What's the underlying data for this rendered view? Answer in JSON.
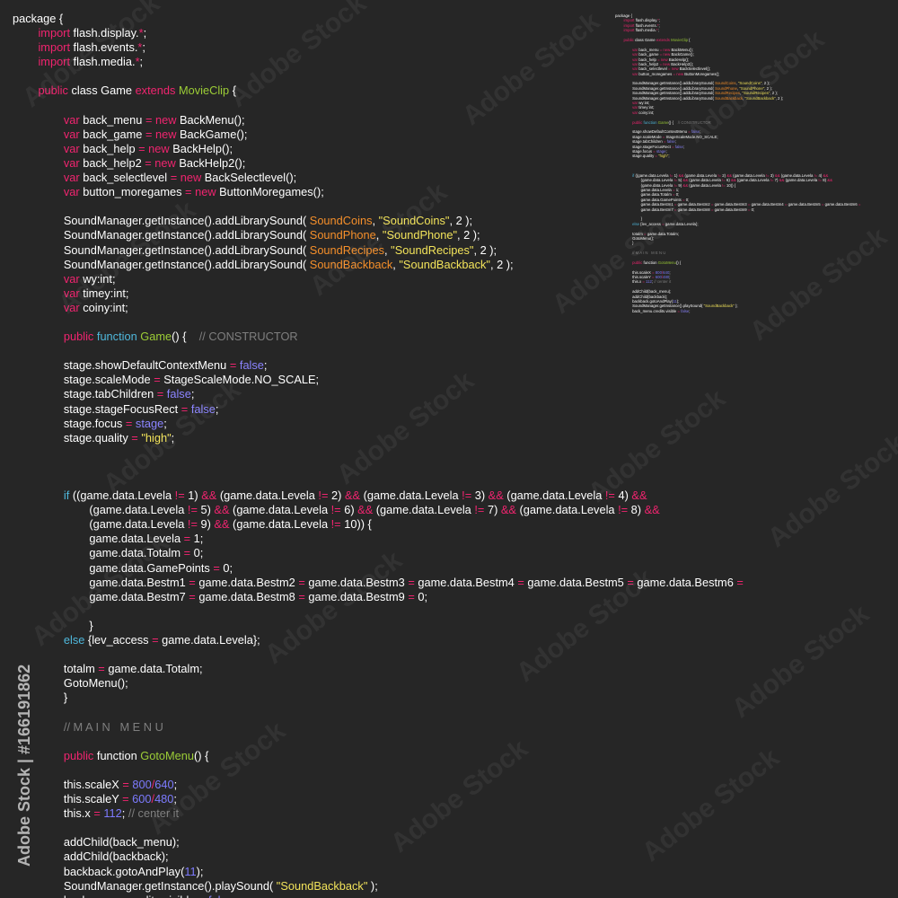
{
  "code": {
    "lines": [
      [
        {
          "t": "package {",
          "c": "plain"
        }
      ],
      [
        {
          "t": "        import",
          "c": "kw"
        },
        {
          "t": " flash.display.",
          "c": "plain"
        },
        {
          "t": "*",
          "c": "kw"
        },
        {
          "t": ";",
          "c": "plain"
        }
      ],
      [
        {
          "t": "        import",
          "c": "kw"
        },
        {
          "t": " flash.events.",
          "c": "plain"
        },
        {
          "t": "*",
          "c": "kw"
        },
        {
          "t": ";",
          "c": "plain"
        }
      ],
      [
        {
          "t": "        import",
          "c": "kw"
        },
        {
          "t": " flash.media.",
          "c": "plain"
        },
        {
          "t": "*",
          "c": "kw"
        },
        {
          "t": ";",
          "c": "plain"
        }
      ],
      [
        {
          "t": "",
          "c": "plain"
        }
      ],
      [
        {
          "t": "        public",
          "c": "kw"
        },
        {
          "t": " class Game ",
          "c": "plain"
        },
        {
          "t": "extends",
          "c": "kw"
        },
        {
          "t": " MovieClip",
          "c": "cls"
        },
        {
          "t": " {",
          "c": "plain"
        }
      ],
      [
        {
          "t": "",
          "c": "plain"
        }
      ],
      [
        {
          "t": "                var",
          "c": "kw"
        },
        {
          "t": " back_menu ",
          "c": "plain"
        },
        {
          "t": "=",
          "c": "kw"
        },
        {
          "t": " new",
          "c": "kw"
        },
        {
          "t": " BackMenu();",
          "c": "plain"
        }
      ],
      [
        {
          "t": "                var",
          "c": "kw"
        },
        {
          "t": " back_game ",
          "c": "plain"
        },
        {
          "t": "=",
          "c": "kw"
        },
        {
          "t": " new",
          "c": "kw"
        },
        {
          "t": " BackGame();",
          "c": "plain"
        }
      ],
      [
        {
          "t": "                var",
          "c": "kw"
        },
        {
          "t": " back_help ",
          "c": "plain"
        },
        {
          "t": "=",
          "c": "kw"
        },
        {
          "t": " new",
          "c": "kw"
        },
        {
          "t": " BackHelp();",
          "c": "plain"
        }
      ],
      [
        {
          "t": "                var",
          "c": "kw"
        },
        {
          "t": " back_help2 ",
          "c": "plain"
        },
        {
          "t": "=",
          "c": "kw"
        },
        {
          "t": " new",
          "c": "kw"
        },
        {
          "t": " BackHelp2();",
          "c": "plain"
        }
      ],
      [
        {
          "t": "                var",
          "c": "kw"
        },
        {
          "t": " back_selectlevel ",
          "c": "plain"
        },
        {
          "t": "=",
          "c": "kw"
        },
        {
          "t": " new",
          "c": "kw"
        },
        {
          "t": " BackSelectlevel();",
          "c": "plain"
        }
      ],
      [
        {
          "t": "                var",
          "c": "kw"
        },
        {
          "t": " button_moregames ",
          "c": "plain"
        },
        {
          "t": "=",
          "c": "kw"
        },
        {
          "t": " new",
          "c": "kw"
        },
        {
          "t": " ButtonMoregames();",
          "c": "plain"
        }
      ],
      [
        {
          "t": "",
          "c": "plain"
        }
      ],
      [
        {
          "t": "                SoundManager.getInstance().addLibrarySound( ",
          "c": "plain"
        },
        {
          "t": "SoundCoins",
          "c": "const"
        },
        {
          "t": ", ",
          "c": "plain"
        },
        {
          "t": "\"SoundCoins\"",
          "c": "str"
        },
        {
          "t": ", 2 );",
          "c": "plain"
        }
      ],
      [
        {
          "t": "                SoundManager.getInstance().addLibrarySound( ",
          "c": "plain"
        },
        {
          "t": "SoundPhone",
          "c": "const"
        },
        {
          "t": ", ",
          "c": "plain"
        },
        {
          "t": "\"SoundPhone\"",
          "c": "str"
        },
        {
          "t": ", 2 );",
          "c": "plain"
        }
      ],
      [
        {
          "t": "                SoundManager.getInstance().addLibrarySound( ",
          "c": "plain"
        },
        {
          "t": "SoundRecipes",
          "c": "const"
        },
        {
          "t": ", ",
          "c": "plain"
        },
        {
          "t": "\"SoundRecipes\"",
          "c": "str"
        },
        {
          "t": ", 2 );",
          "c": "plain"
        }
      ],
      [
        {
          "t": "                SoundManager.getInstance().addLibrarySound( ",
          "c": "plain"
        },
        {
          "t": "SoundBackback",
          "c": "const"
        },
        {
          "t": ", ",
          "c": "plain"
        },
        {
          "t": "\"SoundBackback\"",
          "c": "str"
        },
        {
          "t": ", 2 );",
          "c": "plain"
        }
      ],
      [
        {
          "t": "                var",
          "c": "kw"
        },
        {
          "t": " wy:int;",
          "c": "plain"
        }
      ],
      [
        {
          "t": "                var",
          "c": "kw"
        },
        {
          "t": " timey:int;",
          "c": "plain"
        }
      ],
      [
        {
          "t": "                var",
          "c": "kw"
        },
        {
          "t": " coiny:int;",
          "c": "plain"
        }
      ],
      [
        {
          "t": "",
          "c": "plain"
        }
      ],
      [
        {
          "t": "                public",
          "c": "kw"
        },
        {
          "t": " function",
          "c": "kw2"
        },
        {
          "t": " Game",
          "c": "cls"
        },
        {
          "t": "() {    ",
          "c": "plain"
        },
        {
          "t": "// CONSTRUCTOR",
          "c": "cmt"
        }
      ],
      [
        {
          "t": "",
          "c": "plain"
        }
      ],
      [
        {
          "t": "                stage.showDefaultContextMenu ",
          "c": "plain"
        },
        {
          "t": "=",
          "c": "kw"
        },
        {
          "t": " false",
          "c": "lit"
        },
        {
          "t": ";",
          "c": "plain"
        }
      ],
      [
        {
          "t": "                stage.scaleMode ",
          "c": "plain"
        },
        {
          "t": "=",
          "c": "kw"
        },
        {
          "t": " StageScaleMode.NO_SCALE;",
          "c": "plain"
        }
      ],
      [
        {
          "t": "                stage.tabChildren ",
          "c": "plain"
        },
        {
          "t": "=",
          "c": "kw"
        },
        {
          "t": " false",
          "c": "lit"
        },
        {
          "t": ";",
          "c": "plain"
        }
      ],
      [
        {
          "t": "                stage.stageFocusRect ",
          "c": "plain"
        },
        {
          "t": "=",
          "c": "kw"
        },
        {
          "t": " false",
          "c": "lit"
        },
        {
          "t": ";",
          "c": "plain"
        }
      ],
      [
        {
          "t": "                stage.focus ",
          "c": "plain"
        },
        {
          "t": "=",
          "c": "kw"
        },
        {
          "t": " stage",
          "c": "lit"
        },
        {
          "t": ";",
          "c": "plain"
        }
      ],
      [
        {
          "t": "                stage.quality ",
          "c": "plain"
        },
        {
          "t": "=",
          "c": "kw"
        },
        {
          "t": " \"high\"",
          "c": "str"
        },
        {
          "t": ";",
          "c": "plain"
        }
      ],
      [
        {
          "t": "",
          "c": "plain"
        }
      ],
      [
        {
          "t": "",
          "c": "plain"
        }
      ],
      [
        {
          "t": "",
          "c": "plain"
        }
      ],
      [
        {
          "t": "                if",
          "c": "kw2"
        },
        {
          "t": " ((game.data.Levela ",
          "c": "plain"
        },
        {
          "t": "!=",
          "c": "kw"
        },
        {
          "t": " 1) ",
          "c": "plain"
        },
        {
          "t": "&&",
          "c": "kw"
        },
        {
          "t": " (game.data.Levela ",
          "c": "plain"
        },
        {
          "t": "!=",
          "c": "kw"
        },
        {
          "t": " 2) ",
          "c": "plain"
        },
        {
          "t": "&&",
          "c": "kw"
        },
        {
          "t": " (game.data.Levela ",
          "c": "plain"
        },
        {
          "t": "!=",
          "c": "kw"
        },
        {
          "t": " 3) ",
          "c": "plain"
        },
        {
          "t": "&&",
          "c": "kw"
        },
        {
          "t": " (game.data.Levela ",
          "c": "plain"
        },
        {
          "t": "!=",
          "c": "kw"
        },
        {
          "t": " 4) ",
          "c": "plain"
        },
        {
          "t": "&&",
          "c": "kw"
        }
      ],
      [
        {
          "t": "                        (game.data.Levela ",
          "c": "plain"
        },
        {
          "t": "!=",
          "c": "kw"
        },
        {
          "t": " 5) ",
          "c": "plain"
        },
        {
          "t": "&&",
          "c": "kw"
        },
        {
          "t": " (game.data.Levela ",
          "c": "plain"
        },
        {
          "t": "!=",
          "c": "kw"
        },
        {
          "t": " 6) ",
          "c": "plain"
        },
        {
          "t": "&&",
          "c": "kw"
        },
        {
          "t": " (game.data.Levela ",
          "c": "plain"
        },
        {
          "t": "!=",
          "c": "kw"
        },
        {
          "t": " 7) ",
          "c": "plain"
        },
        {
          "t": "&&",
          "c": "kw"
        },
        {
          "t": " (game.data.Levela ",
          "c": "plain"
        },
        {
          "t": "!=",
          "c": "kw"
        },
        {
          "t": " 8) ",
          "c": "plain"
        },
        {
          "t": "&&",
          "c": "kw"
        }
      ],
      [
        {
          "t": "                        (game.data.Levela ",
          "c": "plain"
        },
        {
          "t": "!=",
          "c": "kw"
        },
        {
          "t": " 9) ",
          "c": "plain"
        },
        {
          "t": "&&",
          "c": "kw"
        },
        {
          "t": " (game.data.Levela ",
          "c": "plain"
        },
        {
          "t": "!=",
          "c": "kw"
        },
        {
          "t": " 10)) {",
          "c": "plain"
        }
      ],
      [
        {
          "t": "                        game.data.Levela ",
          "c": "plain"
        },
        {
          "t": "=",
          "c": "kw"
        },
        {
          "t": " 1;",
          "c": "plain"
        }
      ],
      [
        {
          "t": "                        game.data.Totalm ",
          "c": "plain"
        },
        {
          "t": "=",
          "c": "kw"
        },
        {
          "t": " 0;",
          "c": "plain"
        }
      ],
      [
        {
          "t": "                        game.data.GamePoints ",
          "c": "plain"
        },
        {
          "t": "=",
          "c": "kw"
        },
        {
          "t": " 0;",
          "c": "plain"
        }
      ],
      [
        {
          "t": "                        game.data.Bestm1 ",
          "c": "plain"
        },
        {
          "t": "=",
          "c": "kw"
        },
        {
          "t": " game.data.Bestm2 ",
          "c": "plain"
        },
        {
          "t": "=",
          "c": "kw"
        },
        {
          "t": " game.data.Bestm3 ",
          "c": "plain"
        },
        {
          "t": "=",
          "c": "kw"
        },
        {
          "t": " game.data.Bestm4 ",
          "c": "plain"
        },
        {
          "t": "=",
          "c": "kw"
        },
        {
          "t": " game.data.Bestm5 ",
          "c": "plain"
        },
        {
          "t": "=",
          "c": "kw"
        },
        {
          "t": " game.data.Bestm6 ",
          "c": "plain"
        },
        {
          "t": "=",
          "c": "kw"
        }
      ],
      [
        {
          "t": "                        game.data.Bestm7 ",
          "c": "plain"
        },
        {
          "t": "=",
          "c": "kw"
        },
        {
          "t": " game.data.Bestm8 ",
          "c": "plain"
        },
        {
          "t": "=",
          "c": "kw"
        },
        {
          "t": " game.data.Bestm9 ",
          "c": "plain"
        },
        {
          "t": "=",
          "c": "kw"
        },
        {
          "t": " 0;",
          "c": "plain"
        }
      ],
      [
        {
          "t": "",
          "c": "plain"
        }
      ],
      [
        {
          "t": "                        }",
          "c": "plain"
        }
      ],
      [
        {
          "t": "                else",
          "c": "kw2"
        },
        {
          "t": " {lev_access ",
          "c": "plain"
        },
        {
          "t": "=",
          "c": "kw"
        },
        {
          "t": " game.data.Levela};",
          "c": "plain"
        }
      ],
      [
        {
          "t": "",
          "c": "plain"
        }
      ],
      [
        {
          "t": "                totalm ",
          "c": "plain"
        },
        {
          "t": "=",
          "c": "kw"
        },
        {
          "t": " game.data.Totalm;",
          "c": "plain"
        }
      ],
      [
        {
          "t": "                GotoMenu();",
          "c": "plain"
        }
      ],
      [
        {
          "t": "                }",
          "c": "plain"
        }
      ],
      [
        {
          "t": "",
          "c": "plain"
        }
      ],
      [
        {
          "t": "                // M A I N   M E N U",
          "c": "cmt"
        }
      ],
      [
        {
          "t": "",
          "c": "plain"
        }
      ],
      [
        {
          "t": "                public",
          "c": "kw"
        },
        {
          "t": " function ",
          "c": "plain"
        },
        {
          "t": "GotoMenu",
          "c": "cls"
        },
        {
          "t": "() {",
          "c": "plain"
        }
      ],
      [
        {
          "t": "",
          "c": "plain"
        }
      ],
      [
        {
          "t": "                this.scaleX ",
          "c": "plain"
        },
        {
          "t": "=",
          "c": "kw"
        },
        {
          "t": " 800",
          "c": "num"
        },
        {
          "t": "/",
          "c": "kw"
        },
        {
          "t": "640",
          "c": "num"
        },
        {
          "t": ";",
          "c": "plain"
        }
      ],
      [
        {
          "t": "                this.scaleY ",
          "c": "plain"
        },
        {
          "t": "=",
          "c": "kw"
        },
        {
          "t": " 600",
          "c": "num"
        },
        {
          "t": "/",
          "c": "kw"
        },
        {
          "t": "480",
          "c": "num"
        },
        {
          "t": ";",
          "c": "plain"
        }
      ],
      [
        {
          "t": "                this.x ",
          "c": "plain"
        },
        {
          "t": "=",
          "c": "kw"
        },
        {
          "t": " 112",
          "c": "num"
        },
        {
          "t": "; ",
          "c": "plain"
        },
        {
          "t": "// center it",
          "c": "cmt"
        }
      ],
      [
        {
          "t": "",
          "c": "plain"
        }
      ],
      [
        {
          "t": "                addChild(back_menu);",
          "c": "plain"
        }
      ],
      [
        {
          "t": "                addChild(backback);",
          "c": "plain"
        }
      ],
      [
        {
          "t": "                backback.gotoAndPlay(",
          "c": "plain"
        },
        {
          "t": "11",
          "c": "num"
        },
        {
          "t": ");",
          "c": "plain"
        }
      ],
      [
        {
          "t": "                SoundManager.getInstance().playSound( ",
          "c": "plain"
        },
        {
          "t": "\"SoundBackback\"",
          "c": "str"
        },
        {
          "t": " );",
          "c": "plain"
        }
      ],
      [
        {
          "t": "                back_menu.credits.visible ",
          "c": "plain"
        },
        {
          "t": "=",
          "c": "kw"
        },
        {
          "t": " false",
          "c": "lit"
        },
        {
          "t": ";",
          "c": "plain"
        }
      ]
    ]
  },
  "watermark": {
    "vertical": "Adobe Stock | #166191862",
    "repeat": "Adobe Stock"
  },
  "colors": {
    "background": "#262626",
    "keyword": "#f0246f",
    "keyword_blue": "#4fb8dc",
    "class": "#9ccd36",
    "string": "#f2e35a",
    "number": "#7d7bff",
    "constant": "#f58f2a",
    "comment": "#7f7f7f"
  }
}
